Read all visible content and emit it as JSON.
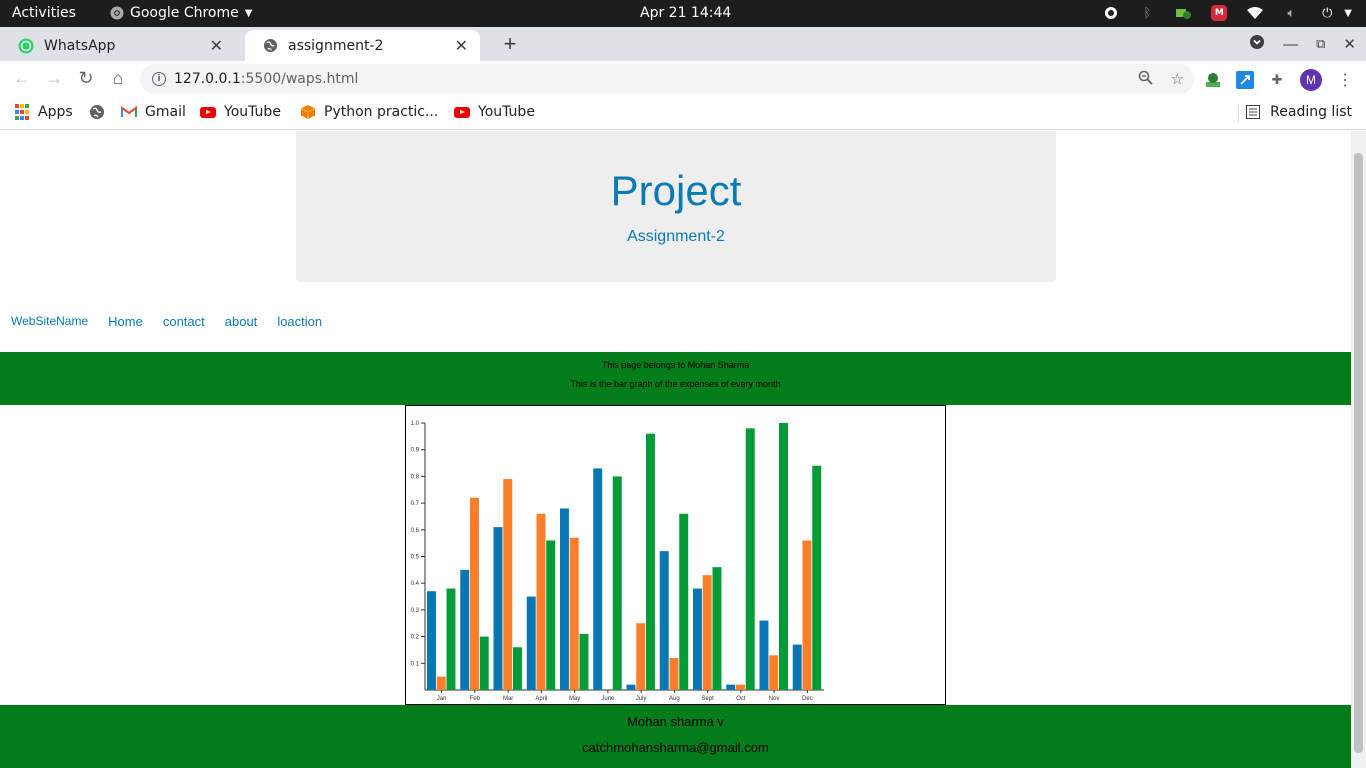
{
  "system": {
    "activities": "Activities",
    "app_name": "Google Chrome",
    "clock": "Apr 21  14:44"
  },
  "browser": {
    "tabs": [
      {
        "title": "WhatsApp",
        "icon": "whatsapp-icon"
      },
      {
        "title": "assignment-2",
        "icon": "globe-icon"
      }
    ],
    "url_host": "127.0.0.1",
    "url_path": ":5500/waps.html",
    "profile_initial": "M",
    "bookmarks": [
      {
        "label": "Apps",
        "icon": "apps-grid-icon"
      },
      {
        "label": "",
        "icon": "globe-icon"
      },
      {
        "label": "Gmail",
        "icon": "gmail-icon"
      },
      {
        "label": "YouTube",
        "icon": "youtube-icon"
      },
      {
        "label": "Python practic...",
        "icon": "cube-icon"
      },
      {
        "label": "YouTube",
        "icon": "youtube-icon"
      }
    ],
    "reading_list": "Reading list"
  },
  "page": {
    "title": "Project",
    "subtitle": "Assignment-2",
    "nav": {
      "brand": "WebSiteName",
      "links": [
        "Home",
        "contact",
        "about",
        "loaction"
      ]
    },
    "banner": {
      "line1": "This page belongs to Mohan Sharma",
      "line2": "This is the bar graph of the expenses of every month"
    },
    "footer": {
      "name": "Mohan sharma v",
      "email": "catchmohansharma@gmail.com"
    },
    "colors": {
      "series_blue": "#0a77b5",
      "series_orange": "#fb7e2b",
      "series_green": "#059b36",
      "band_green": "#027d1a",
      "link_blue": "#0a7bb5"
    }
  },
  "chart_data": {
    "type": "bar",
    "categories": [
      "Jan",
      "Feb",
      "Mar",
      "April",
      "May",
      "June",
      "July",
      "Aug",
      "Sept",
      "Oct",
      "Nov",
      "Dec"
    ],
    "series": [
      {
        "values": [
          0.37,
          0.45,
          0.61,
          0.35,
          0.68,
          0.83,
          0.02,
          0.52,
          0.38,
          0.02,
          0.26,
          0.17
        ]
      },
      {
        "values": [
          0.05,
          0.72,
          0.79,
          0.66,
          0.57,
          0.0,
          0.25,
          0.12,
          0.43,
          0.02,
          0.13,
          0.56
        ]
      },
      {
        "values": [
          0.38,
          0.2,
          0.16,
          0.56,
          0.21,
          0.8,
          0.96,
          0.66,
          0.46,
          0.98,
          1.0,
          0.84
        ]
      }
    ],
    "yticks": [
      "0.1",
      "0.2",
      "0.3",
      "0.4",
      "0.5",
      "0.6",
      "0.7",
      "0.8",
      "0.9",
      "1.0"
    ],
    "ylim": [
      0,
      1.0
    ],
    "grid": false,
    "title": "",
    "xlabel": "",
    "ylabel": ""
  }
}
